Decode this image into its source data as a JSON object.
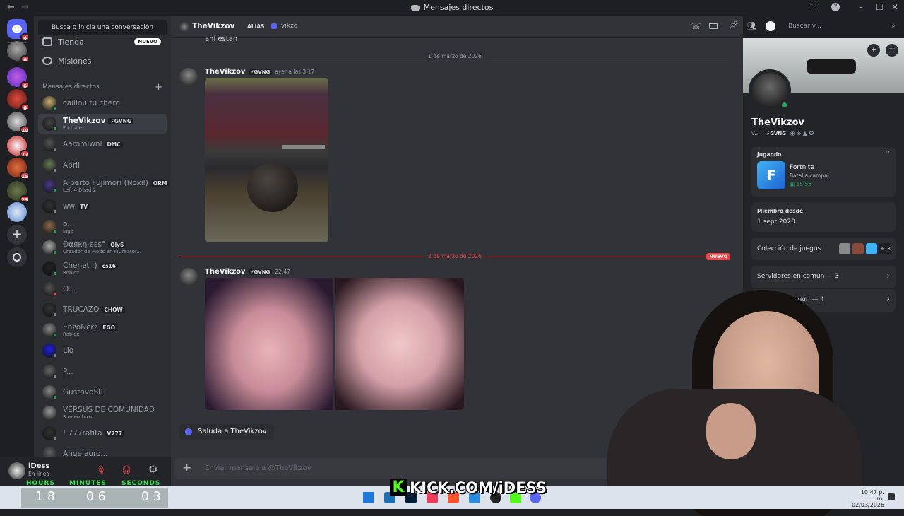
{
  "window": {
    "title": "Mensajes directos"
  },
  "guild_badges": [
    "4",
    "6",
    "6",
    "6",
    "10",
    "77",
    "15",
    "29"
  ],
  "dm_sidebar": {
    "search_label": "Busca o inicia una conversación",
    "nav": [
      {
        "label": "Tienda",
        "badge": "NUEVO"
      },
      {
        "label": "Misiones"
      }
    ],
    "section_header": "Mensajes directos",
    "dms": [
      {
        "name": "caillou tu chero",
        "sub": "",
        "tag": "",
        "status": "#23a55a"
      },
      {
        "name": "TheVikzov",
        "sub": "Fortnite",
        "tag": "⚡GVNG",
        "status": "#23a55a",
        "selected": true
      },
      {
        "name": "Aaromiwnl",
        "sub": "",
        "tag": "DMC",
        "status": "#80848e"
      },
      {
        "name": "Abril",
        "sub": "",
        "tag": "",
        "status": "#80848e"
      },
      {
        "name": "Alberto Fujimori (Noxil)",
        "sub": "Left 4 Dead 2",
        "tag": "ORM",
        "status": "#23a55a"
      },
      {
        "name": "ww",
        "sub": "",
        "tag": "TV",
        "status": "#80848e"
      },
      {
        "name": "o...",
        "sub": "inga",
        "tag": "",
        "status": "#23a55a"
      },
      {
        "name": "Ðαяκη·ess°",
        "sub": "Creador de Mods en MCreator...",
        "tag": "OlyS",
        "status": "#23a55a"
      },
      {
        "name": "Chenet :)",
        "sub": "Roblox",
        "tag": "cs16",
        "status": "#23a55a"
      },
      {
        "name": "O...",
        "sub": "",
        "tag": "",
        "status": "#f23f43"
      },
      {
        "name": "TRUCAZO",
        "sub": "",
        "tag": "CHOW",
        "status": "#80848e"
      },
      {
        "name": "EnzoNerz",
        "sub": "Roblox",
        "tag": "EGO",
        "status": "#23a55a"
      },
      {
        "name": "Lio",
        "sub": "",
        "tag": "",
        "status": "#80848e"
      },
      {
        "name": "P...",
        "sub": "",
        "tag": "",
        "status": "#80848e"
      },
      {
        "name": "GustavoSR",
        "sub": "",
        "tag": "",
        "status": "#23a55a"
      },
      {
        "name": "VERSUS DE COMUNIDAD",
        "sub": "3 miembros",
        "tag": "",
        "status": ""
      },
      {
        "name": "! 777rafita",
        "sub": "",
        "tag": "V777",
        "status": "#80848e"
      },
      {
        "name": "Angelauro...",
        "sub": "",
        "tag": "",
        "status": ""
      }
    ]
  },
  "user_panel": {
    "name": "iDess",
    "status": "En línea"
  },
  "chat": {
    "header": {
      "name": "TheVikzov",
      "alias_label": "ALIAS",
      "alias": "vikzo",
      "search_placeholder": "Buscar v..."
    },
    "prev_text": "ahi estan",
    "divider1": "1 de marzo de 2026",
    "msg1": {
      "author": "TheVikzov",
      "tag": "⚡GVNG",
      "time": "ayer a las 3:17"
    },
    "divider2": "2 de marzo de 2026",
    "new_badge": "NUEVO",
    "msg2": {
      "author": "TheVikzov",
      "tag": "⚡GVNG",
      "time": "22:47"
    },
    "wave_button": "Saluda a TheVikzov",
    "composer_placeholder": "Enviar mensaje a @TheVikzov"
  },
  "profile": {
    "name": "TheVikzov",
    "short": "v...",
    "tag": "⚡GVNG",
    "playing_label": "Jugando",
    "game": "Fortnite",
    "game_mode": "Batalla campal",
    "game_time": "15:56",
    "member_since_label": "Miembro desde",
    "member_since": "1 sept 2020",
    "games_label": "Colección de juegos",
    "games_more": "+18",
    "servers_common": "Servidores en común — 3",
    "friends_common": "...igos en común — 4"
  },
  "overlay": {
    "timer_labels": [
      "HOURS",
      "MINUTES",
      "SECONDS"
    ],
    "timer_values": [
      "18",
      "06",
      "03"
    ],
    "stream_url": "KICK.COM/iDESS",
    "clock_time": "10:47 p. m.",
    "clock_date": "02/03/2026"
  },
  "colors": {
    "accent": "#5865f2",
    "online": "#23a55a",
    "danger": "#f23f43",
    "kick_green": "#53fc18"
  }
}
